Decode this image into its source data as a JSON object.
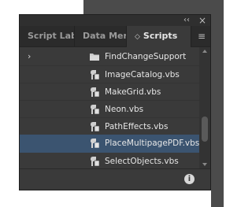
{
  "window": {
    "collapse_glyph": "‹‹",
    "close_glyph": "×"
  },
  "tabs": [
    {
      "label": "Script Labe"
    },
    {
      "label": "Data Merge"
    },
    {
      "label": "Scripts",
      "active": true,
      "chevron": "◇"
    }
  ],
  "menu_glyph": "≡",
  "list": {
    "items": [
      {
        "label": "FindChangeSupport",
        "type": "folder",
        "expanded": false
      },
      {
        "label": "ImageCatalog.vbs",
        "type": "script"
      },
      {
        "label": "MakeGrid.vbs",
        "type": "script"
      },
      {
        "label": "Neon.vbs",
        "type": "script"
      },
      {
        "label": "PathEffects.vbs",
        "type": "script"
      },
      {
        "label": "PlaceMultipagePDF.vbs",
        "type": "script",
        "selected": true
      },
      {
        "label": "SelectObjects.vbs",
        "type": "script"
      }
    ],
    "expand_arrow": "›"
  },
  "footer": {
    "info_glyph": "i"
  },
  "colors": {
    "panel_bg": "#3a3a3a",
    "selected_bg": "#3b5470",
    "text": "#e6e6e6"
  }
}
